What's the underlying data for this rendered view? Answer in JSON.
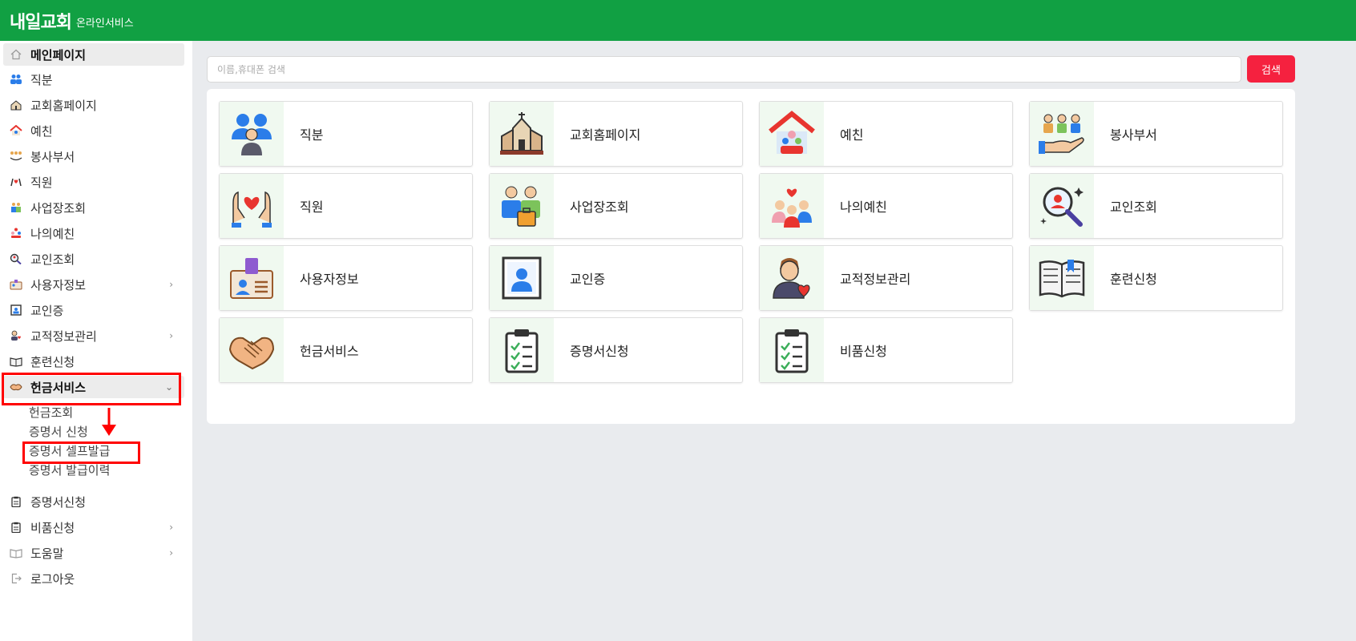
{
  "header": {
    "brand": "내일교회",
    "subtitle": "온라인서비스"
  },
  "sidebar": {
    "items": [
      {
        "label": "메인페이지",
        "icon": "home-icon"
      },
      {
        "label": "직분",
        "icon": "people-icon"
      },
      {
        "label": "교회홈페이지",
        "icon": "church-icon"
      },
      {
        "label": "예친",
        "icon": "house-icon"
      },
      {
        "label": "봉사부서",
        "icon": "volunteer-icon"
      },
      {
        "label": "직원",
        "icon": "staff-icon"
      },
      {
        "label": "사업장조회",
        "icon": "business-icon"
      },
      {
        "label": "나의예친",
        "icon": "family-icon"
      },
      {
        "label": "교인조회",
        "icon": "magnifier-icon"
      },
      {
        "label": "사용자정보",
        "icon": "id-card-icon"
      },
      {
        "label": "교인증",
        "icon": "member-card-icon"
      },
      {
        "label": "교적정보관리",
        "icon": "person-heart-icon"
      },
      {
        "label": "훈련신청",
        "icon": "book-icon"
      },
      {
        "label": "헌금서비스",
        "icon": "handshake-icon"
      },
      {
        "label": "증명서신청",
        "icon": "clipboard-icon"
      },
      {
        "label": "비품신청",
        "icon": "clipboard-icon"
      },
      {
        "label": "도움말",
        "icon": "help-book-icon"
      },
      {
        "label": "로그아웃",
        "icon": "logout-icon"
      }
    ],
    "submenu": [
      "헌금조회",
      "증명서 신청",
      "증명서 셀프발급",
      "증명서 발급이력"
    ]
  },
  "search": {
    "placeholder": "이름,휴대폰 검색",
    "button": "검색"
  },
  "cards": [
    {
      "label": "직분",
      "icon": "people-icon"
    },
    {
      "label": "교회홈페이지",
      "icon": "church-icon"
    },
    {
      "label": "예친",
      "icon": "house-icon"
    },
    {
      "label": "봉사부서",
      "icon": "volunteer-icon"
    },
    {
      "label": "직원",
      "icon": "staff-icon"
    },
    {
      "label": "사업장조회",
      "icon": "business-icon"
    },
    {
      "label": "나의예친",
      "icon": "family-icon"
    },
    {
      "label": "교인조회",
      "icon": "magnifier-icon"
    },
    {
      "label": "사용자정보",
      "icon": "id-card-icon"
    },
    {
      "label": "교인증",
      "icon": "member-card-icon"
    },
    {
      "label": "교적정보관리",
      "icon": "person-heart-icon"
    },
    {
      "label": "훈련신청",
      "icon": "book-icon"
    },
    {
      "label": "헌금서비스",
      "icon": "handshake-icon"
    },
    {
      "label": "증명서신청",
      "icon": "clipboard-icon"
    },
    {
      "label": "비품신청",
      "icon": "clipboard-icon"
    }
  ],
  "colors": {
    "header": "#11a043",
    "search_button": "#f5213f",
    "annotation": "#ff0000"
  }
}
